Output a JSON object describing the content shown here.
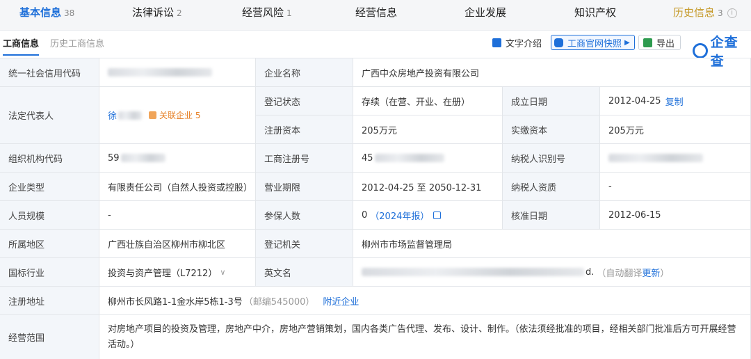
{
  "tabs": [
    {
      "label": "基本信息",
      "count": "38"
    },
    {
      "label": "法律诉讼",
      "count": "2"
    },
    {
      "label": "经营风险",
      "count": "1"
    },
    {
      "label": "经营信息",
      "count": ""
    },
    {
      "label": "企业发展",
      "count": ""
    },
    {
      "label": "知识产权",
      "count": ""
    },
    {
      "label": "历史信息",
      "count": "3"
    }
  ],
  "subtabs": [
    "工商信息",
    "历史工商信息"
  ],
  "tools": {
    "intro": "文字介绍",
    "snapshot": "工商官网快照",
    "export": "导出",
    "logo": "企查查"
  },
  "fields": {
    "credit_code_label": "统一社会信用代码",
    "company_name_label": "企业名称",
    "company_name": "广西中众房地产投资有限公司",
    "legal_rep_label": "法定代表人",
    "legal_rep_name": "徐",
    "related_companies": "关联企业 5",
    "reg_status_label": "登记状态",
    "reg_status": "存续（在营、开业、在册）",
    "found_date_label": "成立日期",
    "found_date": "2012-04-25",
    "copy": "复制",
    "reg_capital_label": "注册资本",
    "reg_capital": "205万元",
    "paid_capital_label": "实缴资本",
    "paid_capital": "205万元",
    "org_code_label": "组织机构代码",
    "org_code_prefix": "59",
    "biz_reg_no_label": "工商注册号",
    "biz_reg_no_prefix": "45",
    "taxpayer_id_label": "纳税人识别号",
    "company_type_label": "企业类型",
    "company_type": "有限责任公司（自然人投资或控股）",
    "term_label": "营业期限",
    "term": "2012-04-25 至 2050-12-31",
    "tax_qual_label": "纳税人资质",
    "tax_qual": "-",
    "staff_size_label": "人员规模",
    "staff_size": "-",
    "insured_label": "参保人数",
    "insured": "0",
    "insured_year": "（2024年报）",
    "approve_date_label": "核准日期",
    "approve_date": "2012-06-15",
    "region_label": "所属地区",
    "region": "广西壮族自治区柳州市柳北区",
    "reg_authority_label": "登记机关",
    "reg_authority": "柳州市市场监督管理局",
    "industry_label": "国标行业",
    "industry": "投资与资产管理（L7212）",
    "english_name_label": "英文名",
    "english_name_tail": "d.",
    "auto_translate": "（自动翻译",
    "update": "更新",
    "auto_translate_end": "）",
    "address_label": "注册地址",
    "address": "柳州市长风路1-1金水岸5栋1-3号",
    "postcode": "（邮编545000）",
    "nearby": "附近企业",
    "scope_label": "经营范围",
    "scope": "对房地产项目的投资及管理，房地产中介，房地产营销策划，国内各类广告代理、发布、设计、制作。（依法须经批准的项目，经相关部门批准后方可开展经营活动。）"
  },
  "colors": {
    "accent": "#1e6fd9",
    "label_bg": "#f3f6fa",
    "history_tab": "#c69a2a"
  }
}
